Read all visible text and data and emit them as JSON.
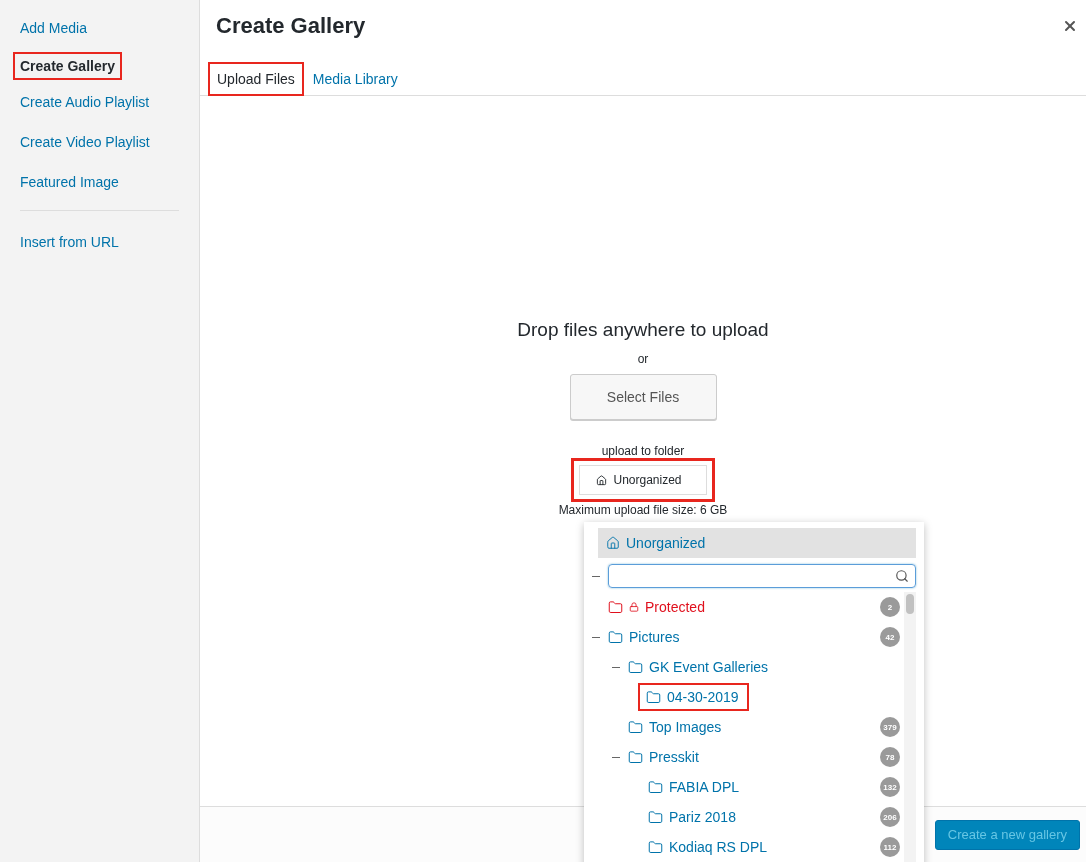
{
  "sidebar": {
    "items": [
      {
        "label": "Add Media",
        "selected": false,
        "highlighted": false
      },
      {
        "label": "Create Gallery",
        "selected": true,
        "highlighted": true
      },
      {
        "label": "Create Audio Playlist",
        "selected": false,
        "highlighted": false
      },
      {
        "label": "Create Video Playlist",
        "selected": false,
        "highlighted": false
      },
      {
        "label": "Featured Image",
        "selected": false,
        "highlighted": false
      }
    ],
    "extra_items": [
      {
        "label": "Insert from URL",
        "selected": false,
        "highlighted": false
      }
    ]
  },
  "title": "Create Gallery",
  "tabs": [
    {
      "label": "Upload Files",
      "selected": true,
      "highlighted": true
    },
    {
      "label": "Media Library",
      "selected": false,
      "highlighted": false
    }
  ],
  "uploader": {
    "heading": "Drop files anywhere to upload",
    "or": "or",
    "select_button": "Select Files",
    "folder_label": "upload to folder",
    "folder_button": {
      "label": "Unorganized",
      "highlighted": true
    },
    "max_size": "Maximum upload file size: 6 GB"
  },
  "folder_dropdown": {
    "root": {
      "label": "Unorganized",
      "expanded": true
    },
    "tree": [
      {
        "label": "Protected",
        "locked": true,
        "color": "#e0101d",
        "count": "2",
        "highlighted": false
      },
      {
        "label": "Pictures",
        "color": "#0073aa",
        "count": "42",
        "expanded": true,
        "highlighted": false,
        "children": [
          {
            "label": "GK Event Galleries",
            "color": "#0073aa",
            "expanded": true,
            "highlighted": false,
            "children": [
              {
                "label": "04-30-2019",
                "color": "#0073aa",
                "highlighted": true
              }
            ]
          },
          {
            "label": "Top Images",
            "color": "#0073aa",
            "count": "379",
            "highlighted": false
          },
          {
            "label": "Presskit",
            "color": "#0073aa",
            "count": "78",
            "expanded": true,
            "highlighted": false,
            "children": [
              {
                "label": "FABIA DPL",
                "color": "#0073aa",
                "count": "132",
                "highlighted": false
              },
              {
                "label": "Pariz 2018",
                "color": "#0073aa",
                "count": "206",
                "highlighted": false
              },
              {
                "label": "Kodiaq RS DPL",
                "color": "#0073aa",
                "count": "112",
                "highlighted": false
              }
            ]
          }
        ]
      }
    ]
  },
  "footer": {
    "button": {
      "label": "Create a new gallery",
      "disabled": true
    }
  }
}
